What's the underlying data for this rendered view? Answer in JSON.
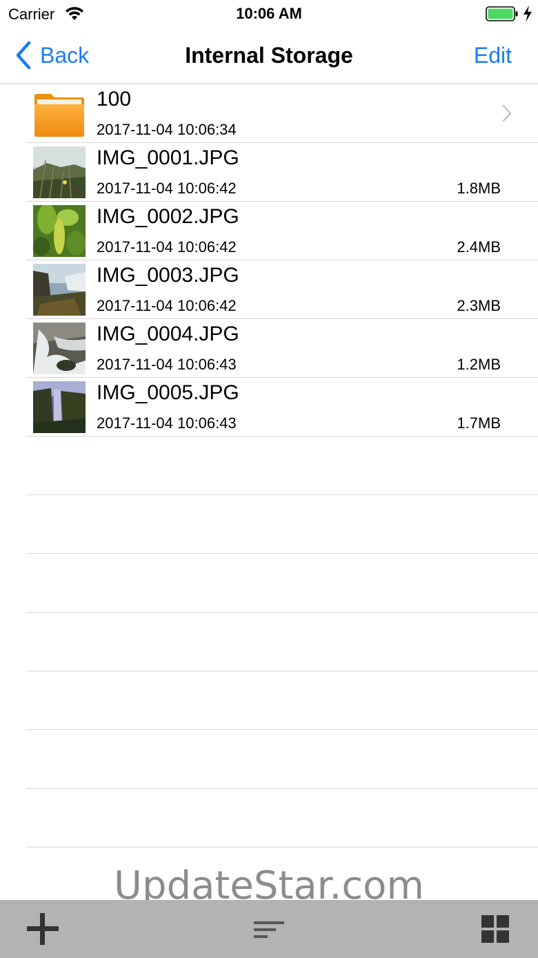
{
  "status_bar": {
    "carrier": "Carrier",
    "time": "10:06 AM",
    "battery_color": "#4cd964"
  },
  "nav": {
    "back_label": "Back",
    "title": "Internal Storage",
    "edit_label": "Edit",
    "accent_color": "#1a7cf5"
  },
  "files": [
    {
      "name": "100",
      "date": "2017-11-04 10:06:34",
      "size": "",
      "kind": "folder"
    },
    {
      "name": "IMG_0001.JPG",
      "date": "2017-11-04 10:06:42",
      "size": "1.8MB",
      "kind": "image"
    },
    {
      "name": "IMG_0002.JPG",
      "date": "2017-11-04 10:06:42",
      "size": "2.4MB",
      "kind": "image"
    },
    {
      "name": "IMG_0003.JPG",
      "date": "2017-11-04 10:06:42",
      "size": "2.3MB",
      "kind": "image"
    },
    {
      "name": "IMG_0004.JPG",
      "date": "2017-11-04 10:06:43",
      "size": "1.2MB",
      "kind": "image"
    },
    {
      "name": "IMG_0005.JPG",
      "date": "2017-11-04 10:06:43",
      "size": "1.7MB",
      "kind": "image"
    }
  ],
  "watermark": "UpdateStar.com",
  "toolbar": {
    "add_icon": "plus-icon",
    "sort_icon": "sort-lines-icon",
    "grid_icon": "grid-view-icon"
  }
}
